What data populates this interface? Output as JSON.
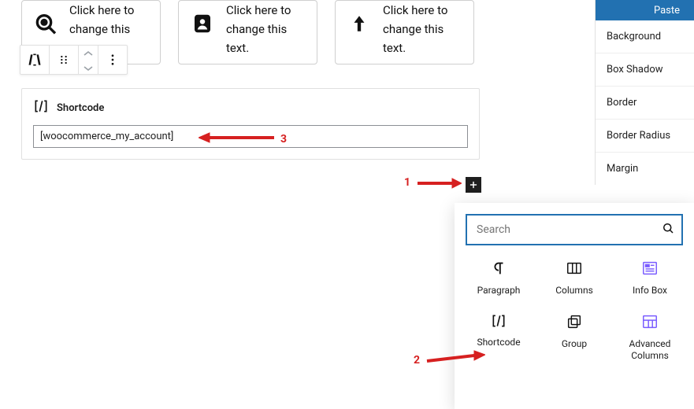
{
  "cards": [
    {
      "text": "Click here to change this"
    },
    {
      "text": "Click here to change this text."
    },
    {
      "text": "Click here to change this text."
    }
  ],
  "shortcode": {
    "header_label": "Shortcode",
    "value": "[woocommerce_my_account]"
  },
  "sidebar": {
    "paste": "Paste",
    "items": [
      "Background",
      "Box Shadow",
      "Border",
      "Border Radius",
      "Margin"
    ]
  },
  "inserter": {
    "search_placeholder": "Search",
    "blocks": [
      {
        "label": "Paragraph"
      },
      {
        "label": "Columns"
      },
      {
        "label": "Info Box"
      },
      {
        "label": "Shortcode"
      },
      {
        "label": "Group"
      },
      {
        "label": "Advanced Columns"
      }
    ]
  },
  "annotations": {
    "n1": "1",
    "n2": "2",
    "n3": "3"
  }
}
